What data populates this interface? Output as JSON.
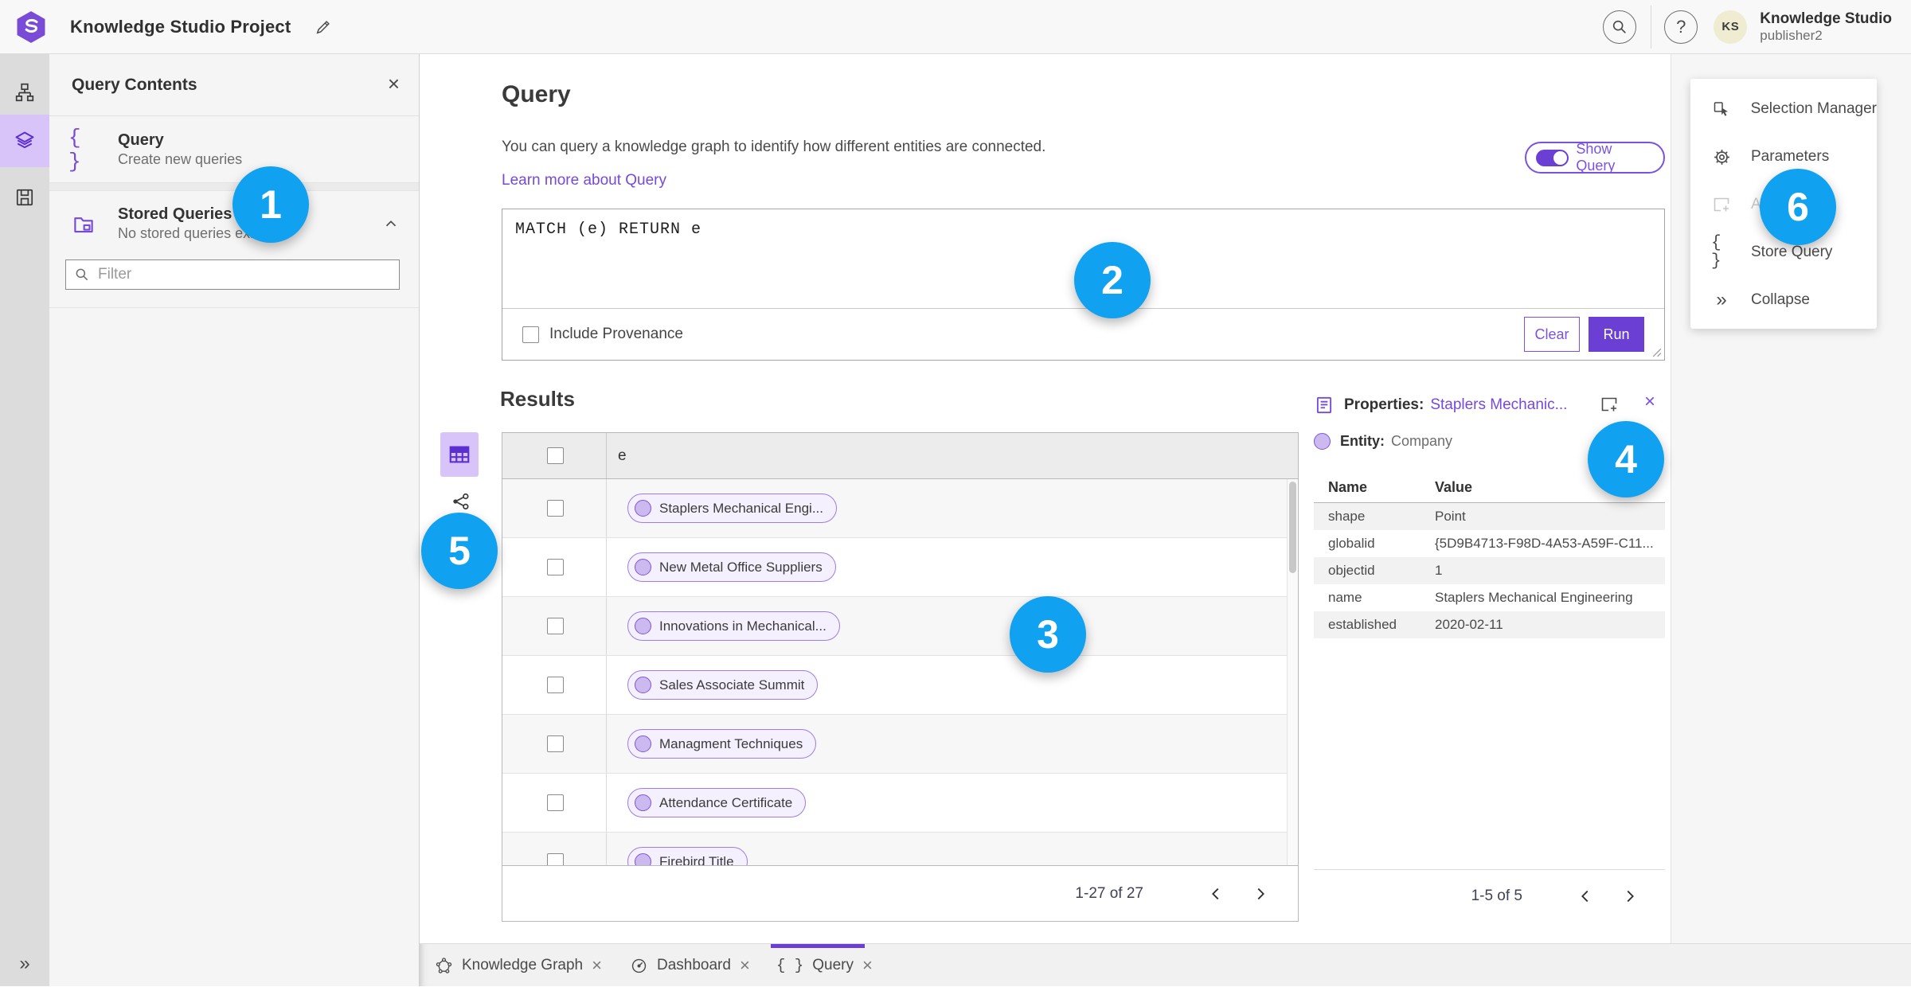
{
  "header": {
    "title": "Knowledge Studio Project",
    "help_glyph": "?",
    "avatar_initials": "KS",
    "user_name": "Knowledge Studio",
    "user_role": "publisher2"
  },
  "left_panel": {
    "title": "Query Contents",
    "close_glyph": "×",
    "braces_glyph": "{ }",
    "query_item": {
      "title": "Query",
      "subtitle": "Create new queries"
    },
    "stored_item": {
      "title": "Stored Queries",
      "subtitle": "No stored queries exist"
    },
    "filter_placeholder": "Filter"
  },
  "query": {
    "heading": "Query",
    "description": "You can query a knowledge graph to identify how different entities are connected.",
    "learn_more": "Learn more about Query",
    "show_query": "Show Query",
    "code": "MATCH (e) RETURN e",
    "include_provenance": "Include Provenance",
    "clear": "Clear",
    "run": "Run"
  },
  "results": {
    "heading": "Results",
    "column_header": "e",
    "rows": [
      "Staplers Mechanical Engi...",
      "New Metal Office Suppliers",
      "Innovations in Mechanical...",
      "Sales Associate Summit",
      "Managment Techniques",
      "Attendance Certificate",
      "Firebird Title"
    ],
    "pagination": "1-27 of 27"
  },
  "properties": {
    "title_label": "Properties:",
    "title_link": "Staplers Mechanic...",
    "close_glyph": "×",
    "entity_label": "Entity:",
    "entity_type": "Company",
    "col_name": "Name",
    "col_value": "Value",
    "rows": [
      {
        "name": "shape",
        "value": "Point"
      },
      {
        "name": "globalid",
        "value": "{5D9B4713-F98D-4A53-A59F-C11..."
      },
      {
        "name": "objectid",
        "value": "1"
      },
      {
        "name": "name",
        "value": "Staplers Mechanical Engineering"
      },
      {
        "name": "established",
        "value": "2020-02-11"
      }
    ],
    "pagination": "1-5 of 5"
  },
  "right_menu": {
    "braces_glyph": "{ }",
    "collapse_glyph": "»",
    "items": [
      {
        "label": "Selection Manager"
      },
      {
        "label": "Parameters"
      },
      {
        "label": "Add To Map"
      },
      {
        "label": "Store Query"
      },
      {
        "label": "Collapse"
      }
    ]
  },
  "rail": {
    "expand_glyph": "»"
  },
  "tabs": [
    {
      "label": "Knowledge Graph",
      "close_glyph": "×"
    },
    {
      "label": "Dashboard",
      "close_glyph": "×"
    },
    {
      "label": "Query",
      "close_glyph": "×",
      "braces_glyph": "{ }"
    }
  ],
  "annotations": [
    "1",
    "2",
    "3",
    "4",
    "5",
    "6"
  ],
  "colors": {
    "accent_purple": "#6b3fd4",
    "link_purple": "#7649d9",
    "annotation_blue": "#10a1f0"
  }
}
